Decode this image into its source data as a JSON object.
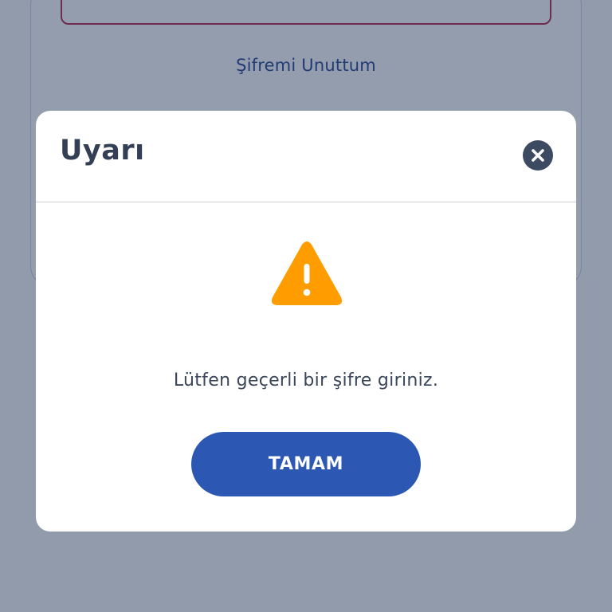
{
  "background": {
    "forgot_password_link": "Şifremi Unuttum"
  },
  "modal": {
    "title": "Uyarı",
    "close_icon": "close-icon",
    "warning_icon": "warning-icon",
    "message": "Lütfen geçerli bir şifre giriniz.",
    "ok_button": "TAMAM"
  },
  "colors": {
    "primary_button": "#2c57b3",
    "warning": "#ff9d00",
    "close_button": "#3d4b62",
    "title_text": "#323f54",
    "error_border": "#b3263f",
    "link": "#1f3f8f"
  }
}
